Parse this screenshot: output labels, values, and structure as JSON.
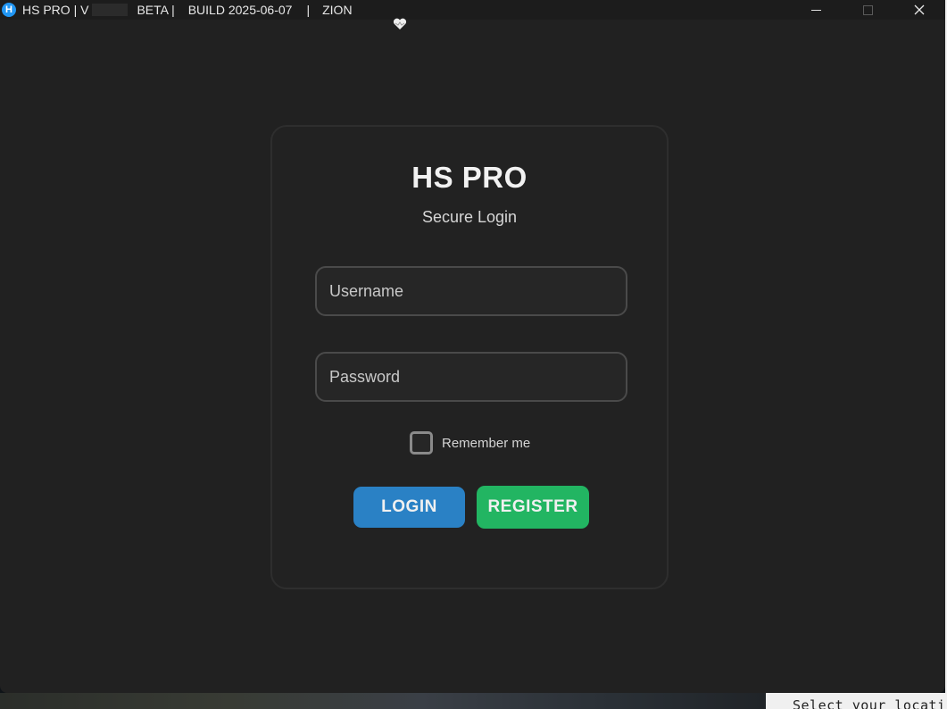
{
  "window": {
    "app_icon_letter": "H",
    "title_prefix": "HS PRO | V",
    "title_beta": "BETA |",
    "title_build": "BUILD 2025-06-07",
    "title_sep": "|",
    "title_user": "ZION",
    "heart_icon": "heart-icon",
    "controls": {
      "minimize": "minimize-icon",
      "maximize": "maximize-icon",
      "close": "close-icon"
    }
  },
  "login": {
    "title": "HS PRO",
    "subtitle": "Secure Login",
    "username_placeholder": "Username",
    "password_placeholder": "Password",
    "remember_label": "Remember me",
    "login_label": "LOGIN",
    "register_label": "REGISTER",
    "colors": {
      "login": "#2a81c5",
      "register": "#22b562",
      "card": "#222222"
    }
  },
  "background": {
    "terminal_text": "Select your locati"
  }
}
